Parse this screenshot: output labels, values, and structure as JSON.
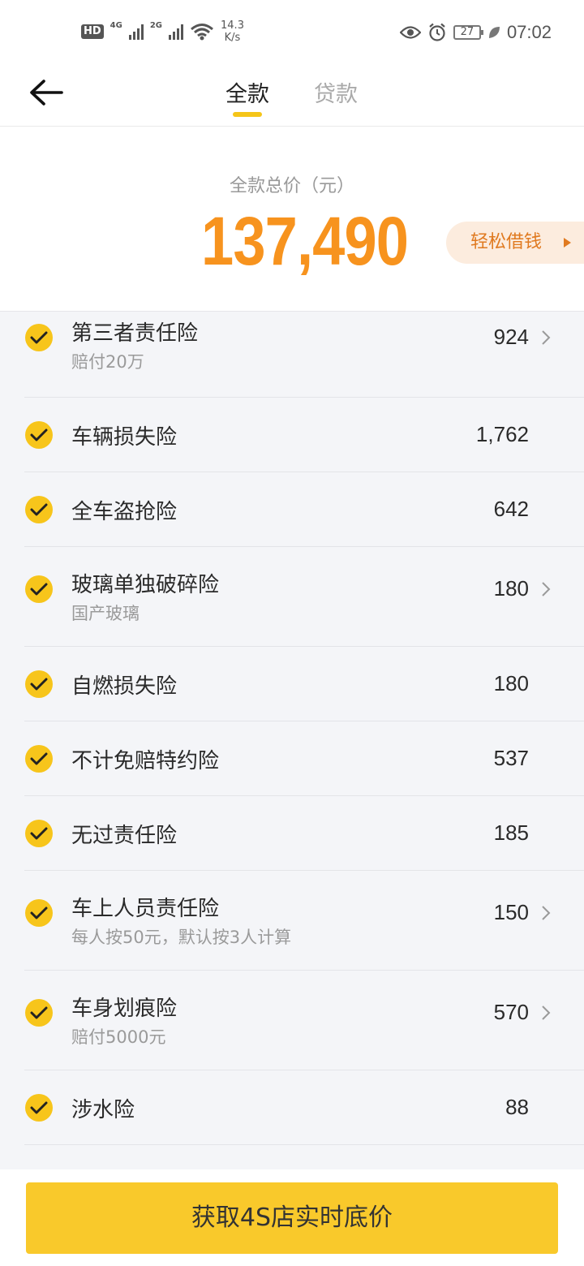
{
  "status_bar": {
    "hd": "HD",
    "net1": "4G",
    "net2": "2G",
    "speed_value": "14.3",
    "speed_unit": "K/s",
    "battery": "27",
    "time": "07:02"
  },
  "header": {
    "tabs": [
      {
        "label": "全款",
        "active": true
      },
      {
        "label": "贷款",
        "active": false
      }
    ]
  },
  "summary": {
    "label": "全款总价（元）",
    "total_price": "137,490",
    "loan_button": "轻松借钱"
  },
  "insurance_items": [
    {
      "title": "第三者责任险",
      "subtitle": "赔付20万",
      "price": "924",
      "checked": true,
      "has_detail": true
    },
    {
      "title": "车辆损失险",
      "subtitle": "",
      "price": "1,762",
      "checked": true,
      "has_detail": false
    },
    {
      "title": "全车盗抢险",
      "subtitle": "",
      "price": "642",
      "checked": true,
      "has_detail": false
    },
    {
      "title": "玻璃单独破碎险",
      "subtitle": "国产玻璃",
      "price": "180",
      "checked": true,
      "has_detail": true
    },
    {
      "title": "自燃损失险",
      "subtitle": "",
      "price": "180",
      "checked": true,
      "has_detail": false
    },
    {
      "title": "不计免赔特约险",
      "subtitle": "",
      "price": "537",
      "checked": true,
      "has_detail": false
    },
    {
      "title": "无过责任险",
      "subtitle": "",
      "price": "185",
      "checked": true,
      "has_detail": false
    },
    {
      "title": "车上人员责任险",
      "subtitle": "每人按50元，默认按3人计算",
      "price": "150",
      "checked": true,
      "has_detail": true
    },
    {
      "title": "车身划痕险",
      "subtitle": "赔付5000元",
      "price": "570",
      "checked": true,
      "has_detail": true
    },
    {
      "title": "涉水险",
      "subtitle": "",
      "price": "88",
      "checked": true,
      "has_detail": false
    }
  ],
  "cta": {
    "label": "获取4S店实时底价"
  },
  "colors": {
    "accent_yellow": "#f7c51b",
    "price_orange": "#f7931e",
    "loan_bg": "#fcecde",
    "list_bg": "#f4f5f8"
  }
}
